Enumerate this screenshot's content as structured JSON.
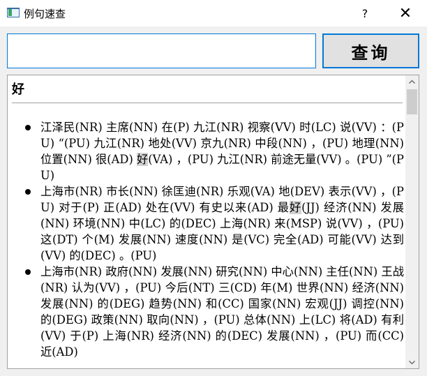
{
  "window": {
    "title": "例句速查",
    "help_glyph": "?",
    "close_glyph": "✕"
  },
  "search": {
    "value": "",
    "button_label": "查询"
  },
  "results": {
    "keyword": "好",
    "examples": [
      {
        "before": "江泽民(NR) 主席(NN) 在(P) 九江(NR) 视察(VV) 时(LC) 说(VV) ：(PU) “(PU) 九江(NR) 地处(VV) 京九(NR) 中段(NN) ，(PU) 地理(NN) 位置(NN) 很(AD) ",
        "highlight": "好",
        "after": "(VA) ，(PU) 九江(NR) 前途无量(VV) 。(PU) ”(PU)"
      },
      {
        "before": "上海市(NR) 市长(NN) 徐匡迪(NR) 乐观(VA) 地(DEV) 表示(VV) ，(PU) 对于(P) 正(AD) 处在(VV) 有史以来(AD) 最",
        "highlight": "好",
        "after": "(JJ) 经济(NN) 发展(NN) 环境(NN) 中(LC) 的(DEC) 上海(NR) 来(MSP) 说(VV) ，(PU) 这(DT) 个(M) 发展(NN) 速度(NN) 是(VC) 完全(AD) 可能(VV) 达到(VV) 的(DEC) 。(PU)"
      },
      {
        "before": "上海市(NR) 政府(NN) 发展(NN) 研究(NN) 中心(NN) 主任(NN) 王战(NR) 认为(VV) ，(PU) 今后(NT) 三(CD) 年(M) 世界(NN) 经济(NN) 发展(NN) 的(DEG) 趋势(NN) 和(CC) 国家(NN) 宏观(JJ) 调控(NN) 的(DEG) 政策(NN) 取向(NN) ，(PU) 总体(NN) 上(LC) 将(AD) 有利(VV) 于(P) 上海(NR) 经济(NN) 的(DEC) 发展(NN) ，(PU) 而(CC) 近(AD)",
        "highlight": "",
        "after": ""
      }
    ]
  },
  "icons": {
    "scroll_up": "scroll-up-arrow",
    "scroll_down": "scroll-down-arrow"
  },
  "colors": {
    "accent": "#0078d7",
    "highlight": "#d3d3d3"
  }
}
